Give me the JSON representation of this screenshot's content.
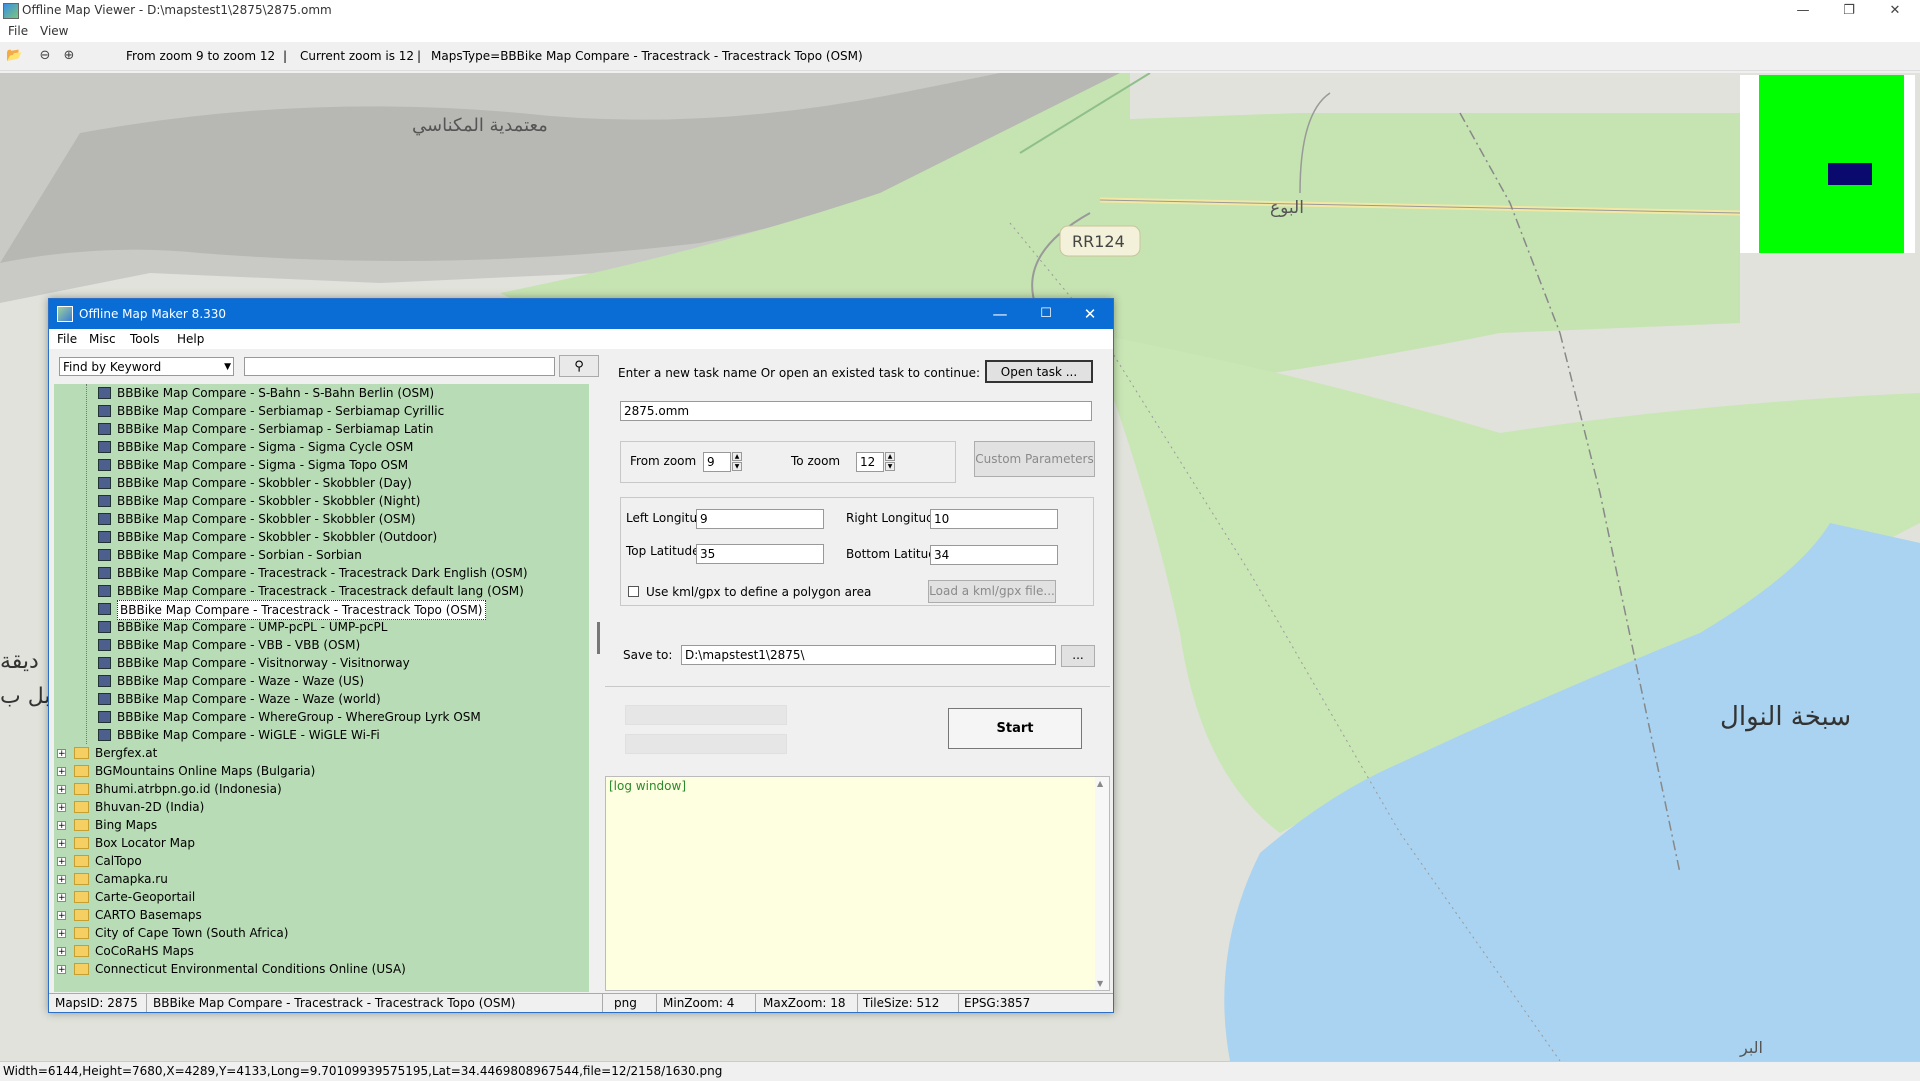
{
  "window": {
    "title": "Offline Map Viewer - D:\\mapstest1\\2875\\2875.omm",
    "menu": [
      "File",
      "View"
    ],
    "controls": {
      "minimize": "—",
      "maximize": "❐",
      "close": "✕"
    }
  },
  "toolbar": {
    "zoom_range": "From zoom 9 to zoom 12",
    "current_zoom": "Current zoom is 12",
    "maps_type": "MapsType=BBBike Map Compare - Tracestrack - Tracestrack Topo (OSM)"
  },
  "map": {
    "labels": [
      "معتمدية المكناسي",
      "البوع",
      "RR124",
      "سبخة النوال",
      "ديقة",
      "بل ب",
      "البر"
    ]
  },
  "statusbar": {
    "text": "Width=6144,Height=7680,X=4289,Y=4133,Long=9.70109939575195,Lat=34.4469808967544,file=12/2158/1630.png"
  },
  "dialog": {
    "title": "Offline Map Maker 8.330",
    "menu": [
      "File",
      "Misc",
      "Tools",
      "Help"
    ],
    "find_mode": "Find by Keyword",
    "search_value": "",
    "tree_leaves": [
      "BBBike Map Compare - S-Bahn - S-Bahn Berlin (OSM)",
      "BBBike Map Compare - Serbiamap - Serbiamap Cyrillic",
      "BBBike Map Compare - Serbiamap - Serbiamap Latin",
      "BBBike Map Compare - Sigma - Sigma Cycle OSM",
      "BBBike Map Compare - Sigma - Sigma Topo OSM",
      "BBBike Map Compare - Skobbler - Skobbler (Day)",
      "BBBike Map Compare - Skobbler - Skobbler (Night)",
      "BBBike Map Compare - Skobbler - Skobbler (OSM)",
      "BBBike Map Compare - Skobbler - Skobbler (Outdoor)",
      "BBBike Map Compare - Sorbian - Sorbian",
      "BBBike Map Compare - Tracestrack - Tracestrack Dark English (OSM)",
      "BBBike Map Compare - Tracestrack - Tracestrack default lang (OSM)",
      "BBBike Map Compare - Tracestrack - Tracestrack Topo (OSM)",
      "BBBike Map Compare - UMP-pcPL - UMP-pcPL",
      "BBBike Map Compare - VBB - VBB (OSM)",
      "BBBike Map Compare - Visitnorway - Visitnorway",
      "BBBike Map Compare - Waze - Waze (US)",
      "BBBike Map Compare - Waze - Waze (world)",
      "BBBike Map Compare - WhereGroup - WhereGroup Lyrk OSM",
      "BBBike Map Compare - WiGLE - WiGLE Wi-Fi"
    ],
    "selected_leaf": "BBBike Map Compare - Tracestrack - Tracestrack Topo (OSM)",
    "tree_folders": [
      "Bergfex.at",
      "BGMountains Online Maps (Bulgaria)",
      "Bhumi.atrbpn.go.id (Indonesia)",
      "Bhuvan-2D (India)",
      "Bing Maps",
      "Box Locator Map",
      "CalTopo",
      "Camapka.ru",
      "Carte-Geoportail",
      "CARTO Basemaps",
      "City of Cape Town (South Africa)",
      "CoCoRaHS Maps",
      "Connecticut Environmental Conditions Online (USA)"
    ],
    "task_prompt": "Enter a new task name Or open an existed task to continue:",
    "open_task_label": "Open task ...",
    "task_name": "2875.omm",
    "from_zoom_label": "From zoom",
    "from_zoom": "9",
    "to_zoom_label": "To zoom",
    "to_zoom": "12",
    "custom_params_label": "Custom Parameters",
    "left_lon_label": "Left Longitude",
    "left_lon": "9",
    "right_lon_label": "Right Longitude",
    "right_lon": "10",
    "top_lat_label": "Top Latitude",
    "top_lat": "35",
    "bottom_lat_label": "Bottom Latitude",
    "bottom_lat": "34",
    "kml_checkbox_label": "Use kml/gpx to define a polygon area",
    "load_kml_label": "Load a kml/gpx file...",
    "save_to_label": "Save to:",
    "save_to": "D:\\mapstest1\\2875\\",
    "browse_label": "...",
    "start_label": "Start",
    "log_text": "[log window]",
    "status": {
      "maps_id": "MapsID: 2875",
      "map_name": "BBBike Map Compare - Tracestrack - Tracestrack Topo (OSM)",
      "format": "png",
      "min_zoom": "MinZoom: 4",
      "max_zoom": "MaxZoom: 18",
      "tile_size": "TileSize: 512",
      "epsg": "EPSG:3857"
    }
  }
}
